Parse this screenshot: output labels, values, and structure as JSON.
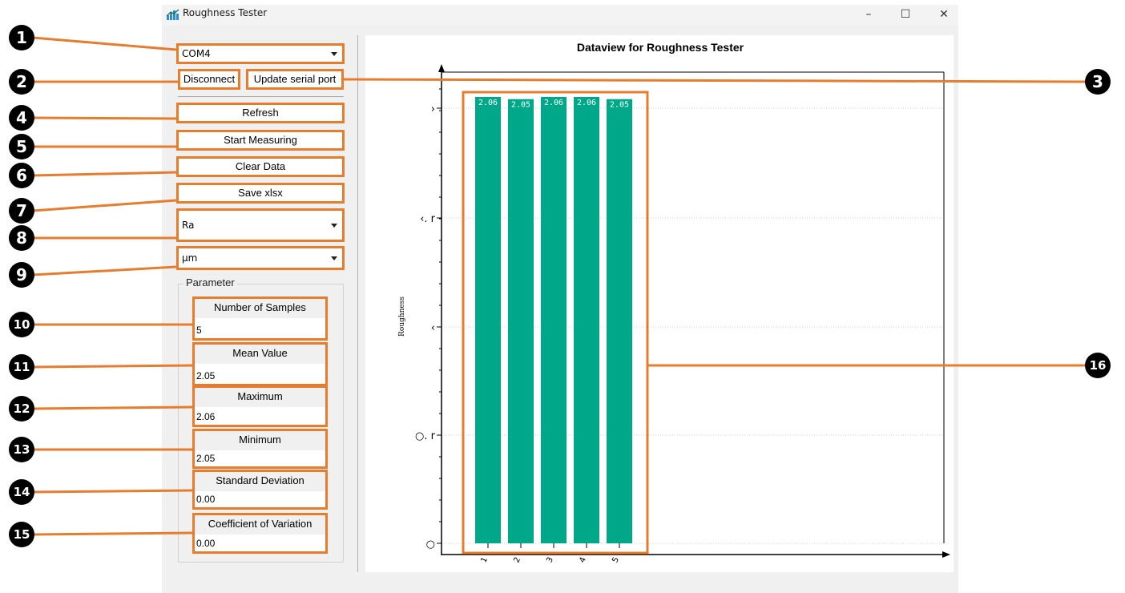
{
  "window": {
    "title": "Roughness Tester",
    "controls": [
      "–",
      "☐",
      "✕"
    ]
  },
  "sidebar": {
    "port_select": "COM4",
    "disconnect_label": "Disconnect",
    "update_port_label": "Update serial port",
    "refresh_label": "Refresh",
    "start_label": "Start Measuring",
    "clear_label": "Clear Data",
    "save_label": "Save xlsx",
    "param_select": "Ra",
    "unit_select": "µm"
  },
  "parameter": {
    "title": "Parameter",
    "fields": [
      {
        "label": "Number of Samples",
        "value": "5"
      },
      {
        "label": "Mean Value",
        "value": "2.05"
      },
      {
        "label": "Maximum",
        "value": "2.06"
      },
      {
        "label": "Minimum",
        "value": "2.05"
      },
      {
        "label": "Standard Deviation",
        "value": "0.00"
      },
      {
        "label": "Coefficient of Variation",
        "value": "0.00"
      }
    ]
  },
  "callouts": [
    "1",
    "2",
    "3",
    "4",
    "5",
    "6",
    "7",
    "8",
    "9",
    "10",
    "11",
    "12",
    "13",
    "14",
    "15",
    "16"
  ],
  "colors": {
    "accent": "#e87c2d",
    "bar": "#00a88a"
  },
  "chart_data": {
    "type": "bar",
    "title": "Dataview for Roughness Tester",
    "ylabel": "Roughness",
    "categories": [
      "1",
      "2",
      "3",
      "4",
      "5"
    ],
    "values": [
      2.06,
      2.05,
      2.06,
      2.06,
      2.05
    ],
    "value_labels": [
      "2.06",
      "2.05",
      "2.06",
      "2.06",
      "2.05"
    ],
    "ytick_labels": [
      "○",
      "○. r",
      "‹",
      "‹. r",
      "›"
    ],
    "grid": true
  }
}
